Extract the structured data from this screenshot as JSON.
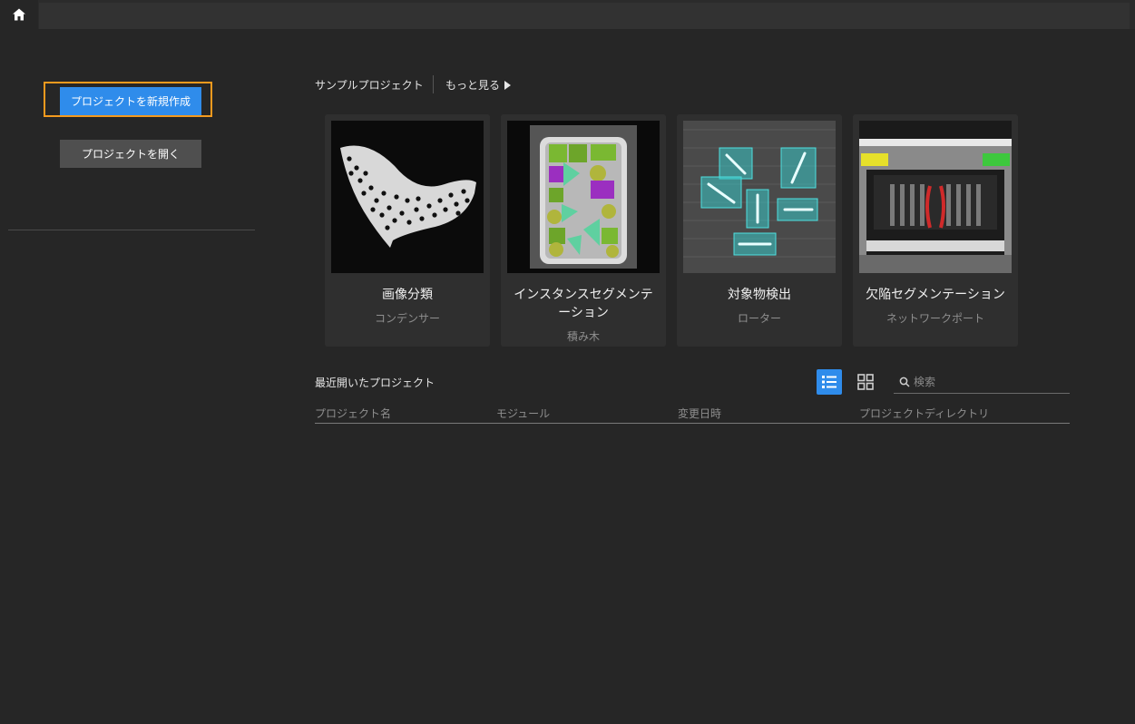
{
  "left": {
    "new_project": "プロジェクトを新規作成",
    "open_project": "プロジェクトを開く"
  },
  "samples": {
    "title": "サンプルプロジェクト",
    "more": "もっと見る",
    "cards": [
      {
        "title": "画像分類",
        "subtitle": "コンデンサー"
      },
      {
        "title": "インスタンスセグメンテーション",
        "subtitle": "積み木"
      },
      {
        "title": "対象物検出",
        "subtitle": "ローター"
      },
      {
        "title": "欠陥セグメンテーション",
        "subtitle": "ネットワークポート"
      }
    ]
  },
  "recent": {
    "title": "最近開いたプロジェクト",
    "search_placeholder": "検索",
    "columns": [
      "プロジェクト名",
      "モジュール",
      "変更日時",
      "プロジェクトディレクトリ"
    ]
  },
  "icons": {
    "home": "home-icon",
    "more_arrow": "triangle-right-icon",
    "list_view": "list-view-icon",
    "grid_view": "grid-view-icon",
    "search": "search-icon"
  },
  "colors": {
    "background": "#262626",
    "accent": "#2f8ceb",
    "highlight": "#f39a1e"
  }
}
